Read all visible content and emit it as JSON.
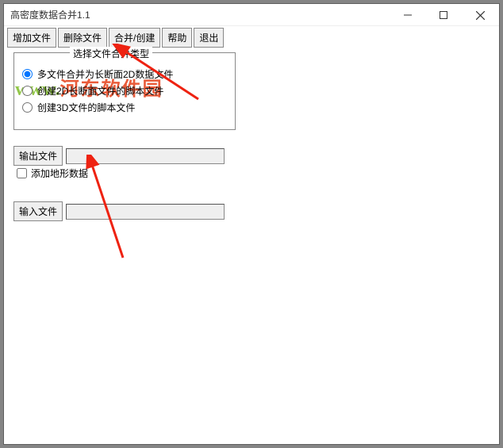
{
  "window": {
    "title": "高密度数据合并1.1"
  },
  "toolbar": {
    "add": "增加文件",
    "delete": "删除文件",
    "merge": "合并/创建",
    "help": "帮助",
    "exit": "退出"
  },
  "group": {
    "legend": "选择文件合并类型",
    "opt1": "多文件合并为长断面2D数据文件",
    "opt2": "创建2D长断面文件的脚本文件",
    "opt3": "创建3D文件的脚本文件"
  },
  "fields": {
    "output_btn": "输出文件",
    "output_value": "",
    "add_terrain": "添加地形数据",
    "input_btn": "输入文件",
    "input_value": ""
  },
  "watermark": {
    "prefix": "www.",
    "text": "河东软件园"
  }
}
